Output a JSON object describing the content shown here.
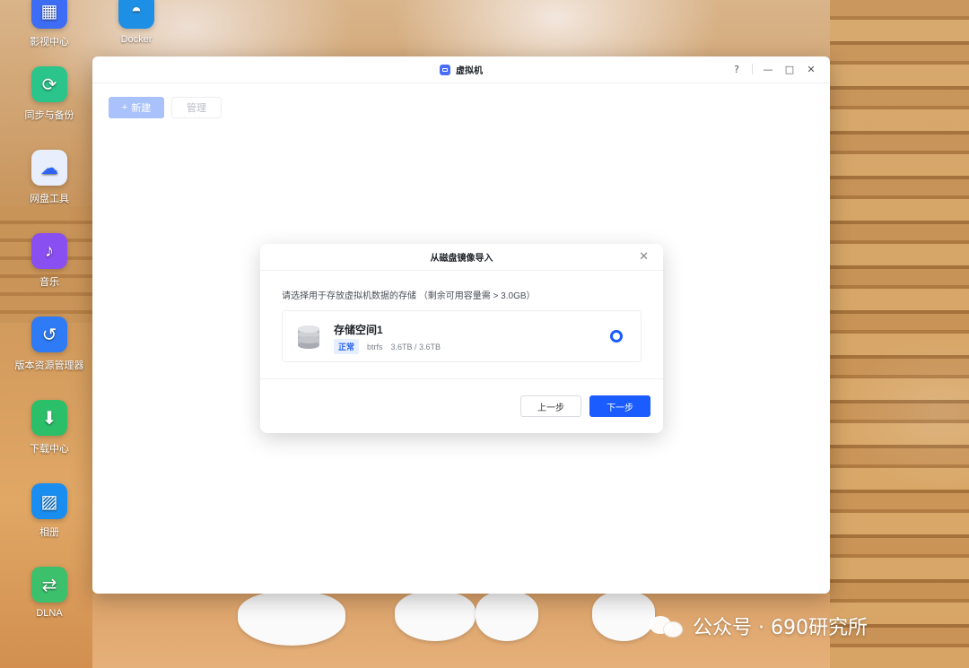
{
  "desktop": {
    "icons": [
      {
        "label": "影视中心",
        "icon": "film-icon",
        "color": "#3d6cf5"
      },
      {
        "label": "Docker",
        "icon": "docker-icon",
        "color": "#1d90e6"
      },
      {
        "label": "同步与备份",
        "icon": "sync-icon",
        "color": "#2bc48a"
      },
      {
        "label": "网盘工具",
        "icon": "cloud-drive-icon",
        "color": "#e8eefb"
      },
      {
        "label": "音乐",
        "icon": "music-icon",
        "color": "#8a4ff0"
      },
      {
        "label": "版本资源管理器",
        "icon": "version-icon",
        "color": "#2f7bf5"
      },
      {
        "label": "下载中心",
        "icon": "download-icon",
        "color": "#2cbf6a"
      },
      {
        "label": "相册",
        "icon": "photo-icon",
        "color": "#1a8df0"
      },
      {
        "label": "DLNA",
        "icon": "dlna-icon",
        "color": "#3cc06c"
      }
    ]
  },
  "window": {
    "title": "虚拟机",
    "controls": {
      "help": "?",
      "minimize": "—",
      "maximize": "□",
      "close": "✕"
    },
    "toolbar": {
      "new_label": "新建",
      "new_icon": "+",
      "manage_label": "管理"
    }
  },
  "dialog": {
    "title": "从磁盘镜像导入",
    "close": "✕",
    "hint": "请选择用于存放虚拟机数据的存储 （剩余可用容量需 > 3.0GB）",
    "storage": {
      "name": "存储空间1",
      "status": "正常",
      "filesystem": "btrfs",
      "capacity": "3.6TB / 3.6TB",
      "selected": true
    },
    "prev_label": "上一步",
    "next_label": "下一步"
  },
  "watermark": {
    "text": "公众号 · 690研究所"
  },
  "colors": {
    "primary": "#1a5cff",
    "disabled_primary": "#a9c2fb",
    "badge_bg": "#e6efff"
  }
}
